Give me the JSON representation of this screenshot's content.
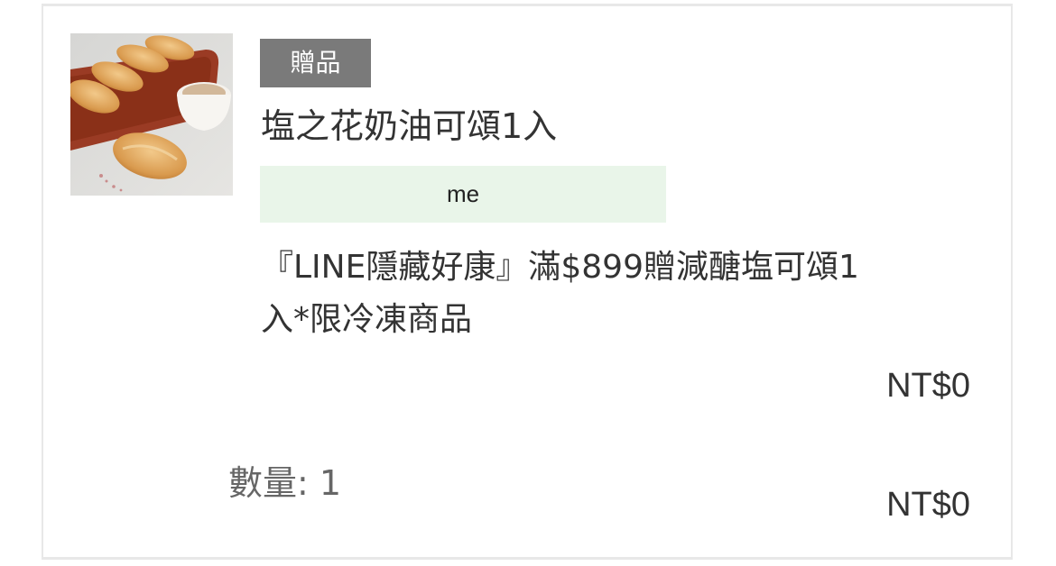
{
  "item": {
    "image_alt": "salt butter croissant rolls with latte",
    "badge": "贈品",
    "name": "塩之花奶油可頌1入",
    "option": "me",
    "promo_line1": "『LINE隱藏好康』滿$899贈減醣塩可頌1",
    "promo_line2": "入*限冷凍商品",
    "unit_price": "NT$0",
    "quantity_text": "數量: 1",
    "subtotal": "NT$0"
  },
  "colors": {
    "badge_bg": "#7a7a7a",
    "option_bg": "#e9f5e9",
    "border": "#e8e8e8"
  }
}
